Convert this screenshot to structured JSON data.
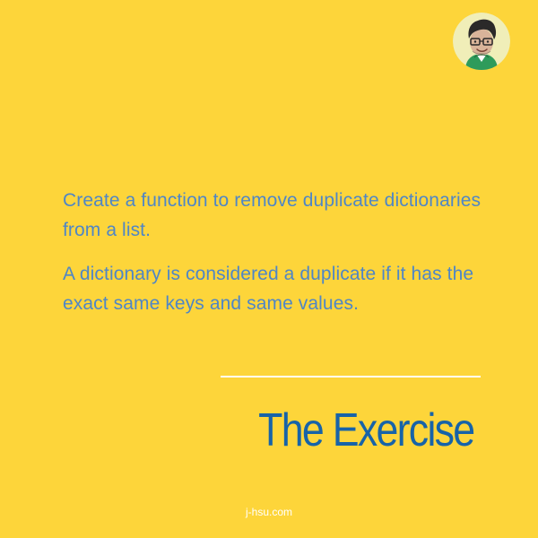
{
  "content": {
    "paragraphs": [
      "Create a function to remove duplicate dictionaries from a list.",
      "A dictionary is considered a duplicate if it has the exact same keys and same values."
    ],
    "heading": "The Exercise",
    "footer": "j-hsu.com"
  },
  "colors": {
    "background": "#fdd53a",
    "body_text": "#4f86c6",
    "heading": "#1763a8",
    "divider": "#ffffff",
    "footer": "#ffffff"
  },
  "icons": {
    "avatar": "cartoon-man-avatar-icon"
  }
}
